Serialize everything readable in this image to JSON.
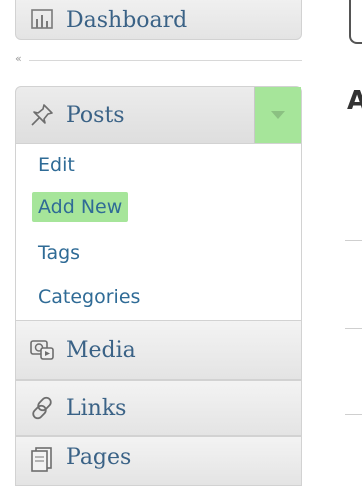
{
  "sidebar": {
    "dashboard": {
      "label": "Dashboard",
      "icon": "dashboard-icon"
    },
    "collapse": {
      "glyph": "«"
    },
    "posts": {
      "label": "Posts",
      "icon": "pushpin-icon",
      "toggle_icon": "chevron-down-icon",
      "submenu": [
        {
          "label": "Edit",
          "active": false
        },
        {
          "label": "Add New",
          "active": true
        },
        {
          "label": "Tags",
          "active": false
        },
        {
          "label": "Categories",
          "active": false
        }
      ]
    },
    "media": {
      "label": "Media",
      "icon": "media-icon"
    },
    "links": {
      "label": "Links",
      "icon": "link-icon"
    },
    "pages": {
      "label": "Pages",
      "icon": "pages-icon"
    }
  },
  "content": {
    "heading_fragment": "A"
  },
  "colors": {
    "highlight": "#a6e59a",
    "link": "#2f6b96",
    "menu_text": "#3a6286"
  }
}
